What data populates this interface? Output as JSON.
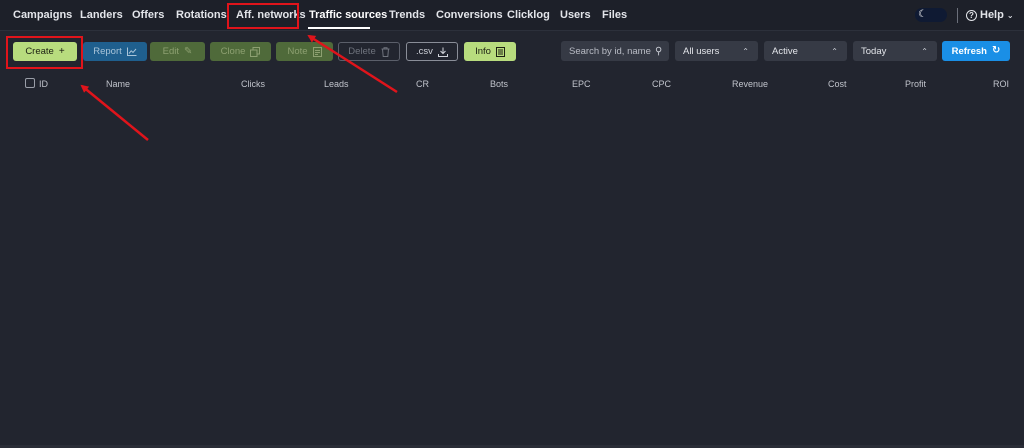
{
  "nav": {
    "items": [
      {
        "label": "Campaigns",
        "active": false
      },
      {
        "label": "Landers",
        "active": false
      },
      {
        "label": "Offers",
        "active": false
      },
      {
        "label": "Rotations",
        "active": false
      },
      {
        "label": "Aff. networks",
        "active": false
      },
      {
        "label": "Traffic sources",
        "active": true
      },
      {
        "label": "Trends",
        "active": false
      },
      {
        "label": "Conversions",
        "active": false
      },
      {
        "label": "Clicklog",
        "active": false
      },
      {
        "label": "Users",
        "active": false
      },
      {
        "label": "Files",
        "active": false
      }
    ],
    "theme_icon": "moon-icon",
    "help_label": "Help"
  },
  "toolbar": {
    "create_label": "Create",
    "report_label": "Report",
    "edit_label": "Edit",
    "clone_label": "Clone",
    "note_label": "Note",
    "delete_label": "Delete",
    "csv_label": ".csv",
    "info_label": "Info",
    "search_placeholder": "Search by id, name",
    "users_select": "All users",
    "status_select": "Active",
    "date_select": "Today",
    "refresh_label": "Refresh"
  },
  "table": {
    "columns": [
      "ID",
      "Name",
      "Clicks",
      "Leads",
      "CR",
      "Bots",
      "EPC",
      "CPC",
      "Revenue",
      "Cost",
      "Profit",
      "ROI"
    ]
  },
  "colors": {
    "background": "#22252f",
    "accent_green": "#b8dc7e",
    "accent_blue": "#1a8fe6",
    "annotation_red": "#e0141b"
  }
}
